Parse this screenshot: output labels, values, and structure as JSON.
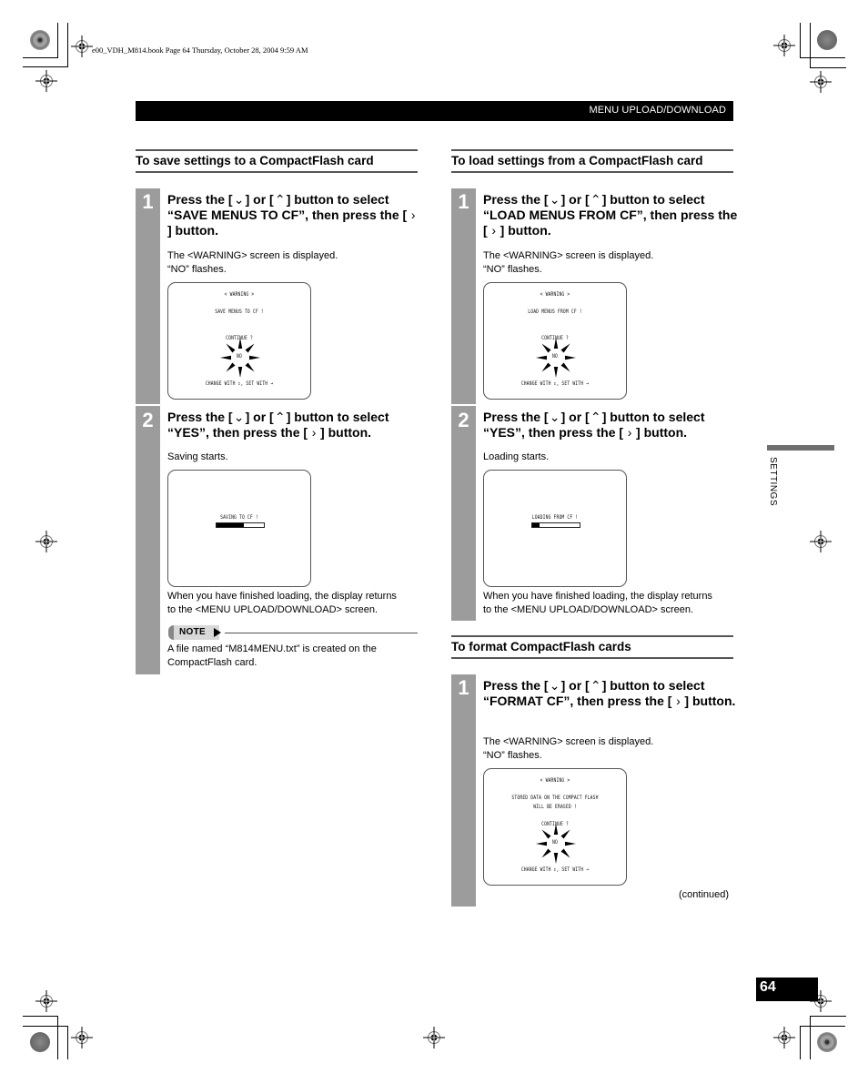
{
  "print_header": {
    "book_info": "e00_VDH_M814.book  Page 64  Thursday, October 28, 2004  9:59 AM"
  },
  "header": {
    "title": "MENU UPLOAD/DOWNLOAD"
  },
  "side_tab": {
    "label": "SETTINGS"
  },
  "icons": {
    "down_button": "⌄",
    "up_button": "⌃",
    "right_button": "›"
  },
  "left_column": {
    "heading": "To save settings to a CompactFlash card",
    "steps": [
      {
        "number": "1",
        "title_parts": [
          "Press the [",
          "] or [",
          "] button to select “SAVE MENUS TO CF”, then press the [",
          "] button."
        ],
        "body": [
          "The <WARNING> screen is displayed.",
          "“NO” flashes."
        ],
        "screen": {
          "lines": [
            "< WARNING >",
            "SAVE MENUS TO CF !",
            "CONTINUE ?",
            "NO",
            "CHANGE WITH ↕,   SET WITH →"
          ]
        }
      },
      {
        "number": "2",
        "title_parts": [
          "Press the [",
          "] or [",
          "] button to select “YES”, then press the [",
          "] button."
        ],
        "body": [
          "Saving starts."
        ],
        "screen": {
          "lines": [
            "SAVING TO CF !"
          ],
          "progress": 0.58
        },
        "after": [
          "When you have finished loading, the display returns",
          "to the <MENU UPLOAD/DOWNLOAD> screen."
        ]
      }
    ],
    "note": {
      "label": "NOTE",
      "text": [
        "A file named “M814MENU.txt” is created on the",
        "CompactFlash card."
      ]
    }
  },
  "right_column": {
    "load": {
      "heading": "To load settings from a CompactFlash card",
      "steps": [
        {
          "number": "1",
          "title_parts": [
            "Press the [",
            "] or [",
            "] button to select “LOAD MENUS FROM CF”, then press the [",
            "] button."
          ],
          "body": [
            "The <WARNING> screen is displayed.",
            "“NO” flashes."
          ],
          "screen": {
            "lines": [
              "< WARNING >",
              "LOAD MENUS FROM CF !",
              "CONTINUE ?",
              "NO",
              "CHANGE WITH ↕,   SET WITH →"
            ]
          }
        },
        {
          "number": "2",
          "title_parts": [
            "Press the [",
            "] or [",
            "] button to select “YES”, then press the [",
            "] button."
          ],
          "body": [
            "Loading starts."
          ],
          "screen": {
            "lines": [
              "LOADING FROM CF !"
            ],
            "progress": 0.15
          },
          "after": [
            "When you have finished loading, the display returns",
            "to the <MENU UPLOAD/DOWNLOAD> screen."
          ]
        }
      ]
    },
    "format": {
      "heading": "To format CompactFlash cards",
      "steps": [
        {
          "number": "1",
          "title_parts": [
            "Press the [",
            "] or [",
            "] button to select “FORMAT CF”, then press the [",
            "] button."
          ],
          "body": [
            "The <WARNING> screen is displayed.",
            "“NO” flashes."
          ],
          "screen": {
            "lines": [
              "< WARNING >",
              "STORED DATA ON THE COMPACT FLASH",
              "WILL BE ERASED !",
              "CONTINUE ?",
              "NO",
              "CHANGE WITH ↕,   SET WITH →"
            ]
          }
        }
      ]
    }
  },
  "footer": {
    "continued": "(continued)",
    "page_number": "64"
  }
}
